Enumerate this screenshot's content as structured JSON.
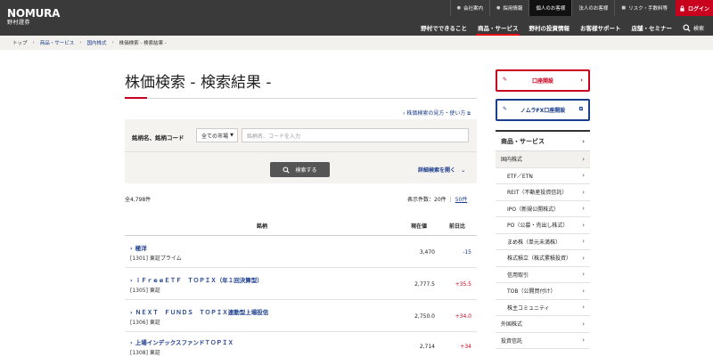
{
  "header": {
    "logo_main": "NOMURA",
    "logo_sub": "野村證券",
    "topnav": [
      "会社案内",
      "採用情報",
      "個人のお客様",
      "法人のお客様",
      "リスク・手数料等"
    ],
    "login": "ログイン",
    "mainnav": [
      "野村でできること",
      "商品・サービス",
      "野村の投資情報",
      "お客様サポート",
      "店舗・セミナー"
    ],
    "search": "検索"
  },
  "breadcrumb": [
    "トップ",
    "商品・サービス",
    "国内株式",
    "株価検索 - 検索結果 -"
  ],
  "page": {
    "title": "株価検索 - 検索結果 -",
    "howto": "株価検索の見方・使い方"
  },
  "search": {
    "label": "銘柄名、銘柄コード",
    "market": "全ての市場",
    "placeholder": "銘柄名、コードを入力",
    "button": "検索する",
    "detail": "詳細検索を開く"
  },
  "results": {
    "count": "全4,798件",
    "perpage_label": "表示件数：",
    "perpage_20": "20件",
    "perpage_50": "50件",
    "headers": [
      "銘柄",
      "現在値",
      "前日比"
    ],
    "rows": [
      {
        "name": "極洋",
        "code": "[1301] 東証プライム",
        "price": "3,470",
        "change": "-15",
        "dir": "down"
      },
      {
        "name": "ｉＦｒｅｅＥＴＦ　ＴＯＰＩＸ（年１回決算型）",
        "code": "[1305] 東証",
        "price": "2,777.5",
        "change": "+35.5",
        "dir": "up"
      },
      {
        "name": "ＮＥＸＴ　ＦＵＮＤＳ　ＴＯＰＩＸ連動型上場投信",
        "code": "[1306] 東証",
        "price": "2,750.0",
        "change": "+34.0",
        "dir": "up"
      },
      {
        "name": "上場インデックスファンドＴＯＰＩＸ",
        "code": "[1308] 東証",
        "price": "2,714",
        "change": "+34",
        "dir": "up"
      }
    ]
  },
  "sidebar": {
    "cta1": "口座開設",
    "cta2": "ノムラFX口座開設",
    "menu_head": "商品・サービス",
    "items": [
      {
        "label": "国内株式",
        "sub": false,
        "sel": true
      },
      {
        "label": "ETF／ETN",
        "sub": true
      },
      {
        "label": "REIT（不動産投資信託）",
        "sub": true
      },
      {
        "label": "IPO（新規公開株式）",
        "sub": true
      },
      {
        "label": "PO（公募・売出し株式）",
        "sub": true
      },
      {
        "label": "まめ株（単元未満株）",
        "sub": true
      },
      {
        "label": "株式積立（株式累積投資）",
        "sub": true
      },
      {
        "label": "信用取引",
        "sub": true
      },
      {
        "label": "TOB（公開買付け）",
        "sub": true
      },
      {
        "label": "株主コミュニティ",
        "sub": true
      },
      {
        "label": "外国株式",
        "sub": false
      },
      {
        "label": "投資信託",
        "sub": false
      }
    ]
  },
  "colors": {
    "brand_red": "#c8001e",
    "link_blue": "#1a3c8c",
    "header_bg": "#3a3a3a"
  }
}
